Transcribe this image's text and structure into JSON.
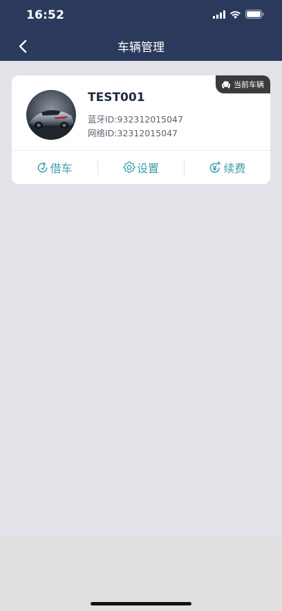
{
  "status_bar": {
    "time": "16:52",
    "icons": [
      "signal-icon",
      "wifi-icon",
      "battery-icon"
    ]
  },
  "header": {
    "back_icon": "chevron-left-icon",
    "title": "车辆管理"
  },
  "vehicle_card": {
    "badge_icon": "car-icon",
    "badge_label": "当前车辆",
    "name": "TEST001",
    "bluetooth_id": "蓝牙ID:932312015047",
    "network_id": "网络ID:32312015047",
    "actions": [
      {
        "icon": "borrow-icon",
        "label": "借车"
      },
      {
        "icon": "gear-icon",
        "label": "设置"
      },
      {
        "icon": "yen-renew-icon",
        "label": "续费"
      }
    ]
  },
  "colors": {
    "header_bg": "#2b3a5c",
    "page_bg": "#e1e3e8",
    "accent": "#3aa0a8",
    "badge_bg": "#3b3b3b"
  }
}
